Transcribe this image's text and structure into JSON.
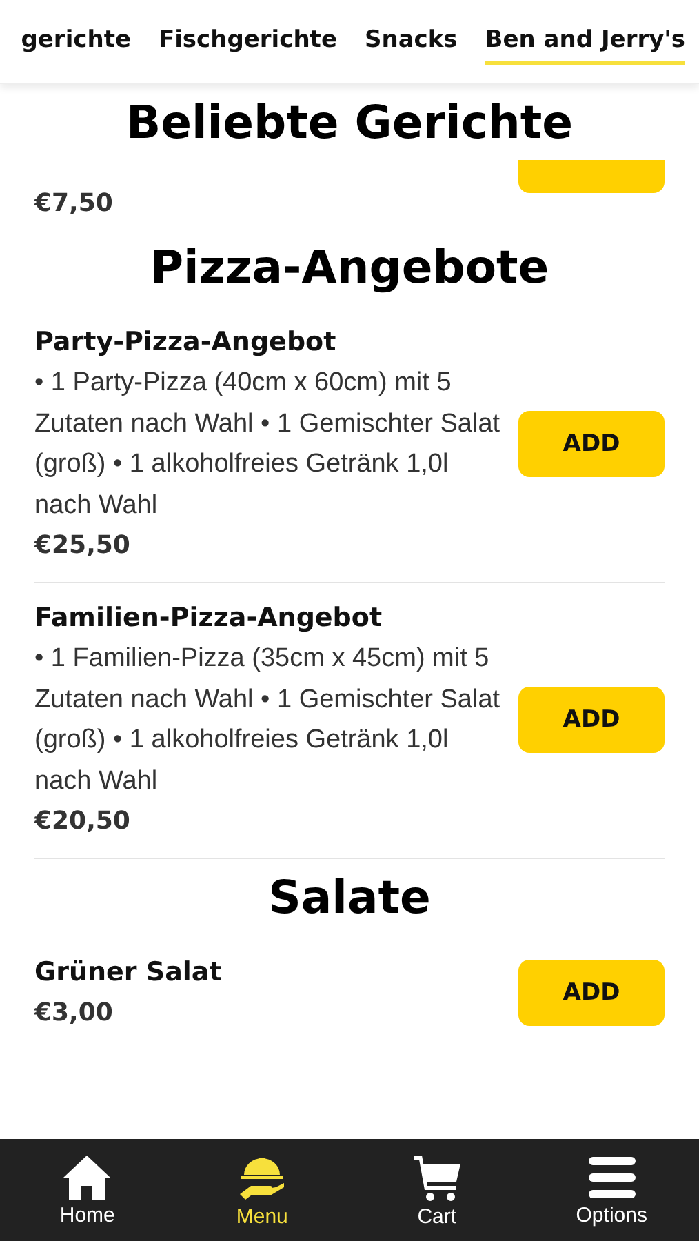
{
  "tabs": [
    {
      "label": "gerichte",
      "selected": false
    },
    {
      "label": "Fischgerichte",
      "selected": false
    },
    {
      "label": "Snacks",
      "selected": false
    },
    {
      "label": "Ben and Jerry's",
      "selected": true
    }
  ],
  "sections": [
    {
      "title": "Beliebte Gerichte",
      "items": [
        {
          "kind": "clipped",
          "price": "€7,50"
        }
      ]
    },
    {
      "title": "Pizza-Angebote",
      "items": [
        {
          "kind": "full",
          "name": "Party-Pizza-Angebot",
          "description": "• 1 Party-Pizza (40cm x 60cm) mit 5 Zutaten nach Wahl • 1 Gemischter Salat (groß) • 1 alkoholfreies Getränk 1,0l nach Wahl",
          "price": "€25,50",
          "button": "ADD"
        },
        {
          "kind": "full",
          "name": "Familien-Pizza-Angebot",
          "description": "• 1 Familien-Pizza (35cm x 45cm) mit 5 Zutaten nach Wahl • 1 Gemischter Salat (groß) • 1 alkoholfreies Getränk 1,0l nach Wahl",
          "price": "€20,50",
          "button": "ADD"
        }
      ]
    },
    {
      "title": "Salate",
      "items": [
        {
          "kind": "full",
          "name": "Grüner Salat",
          "price": "€3,00",
          "button": "ADD"
        }
      ]
    }
  ],
  "nav": [
    {
      "kind": "home",
      "label": "Home",
      "selected": false
    },
    {
      "kind": "menu",
      "label": "Menu",
      "selected": true
    },
    {
      "kind": "cart",
      "label": "Cart",
      "selected": false
    },
    {
      "kind": "options",
      "label": "Options",
      "selected": false
    }
  ]
}
